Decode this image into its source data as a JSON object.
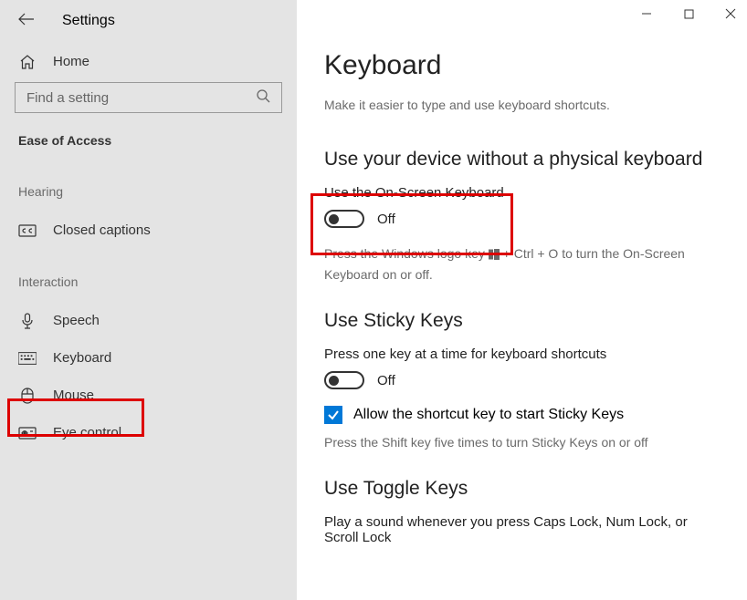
{
  "app_title": "Settings",
  "search_placeholder": "Find a setting",
  "home_label": "Home",
  "category_title": "Ease of Access",
  "sections": {
    "hearing": "Hearing",
    "interaction": "Interaction"
  },
  "nav": {
    "closed_captions": "Closed captions",
    "speech": "Speech",
    "keyboard": "Keyboard",
    "mouse": "Mouse",
    "eye_control": "Eye control"
  },
  "main": {
    "title": "Keyboard",
    "subtitle": "Make it easier to type and use keyboard shortcuts.",
    "osk_heading": "Use your device without a physical keyboard",
    "osk_label": "Use the On-Screen Keyboard",
    "osk_state": "Off",
    "osk_hint_pre": "Press the Windows logo key ",
    "osk_hint_post": " + Ctrl + O to turn the On-Screen Keyboard on or off.",
    "sticky_heading": "Use Sticky Keys",
    "sticky_label": "Press one key at a time for keyboard shortcuts",
    "sticky_state": "Off",
    "sticky_checkbox": "Allow the shortcut key to start Sticky Keys",
    "sticky_hint": "Press the Shift key five times to turn Sticky Keys on or off",
    "toggle_heading": "Use Toggle Keys",
    "toggle_label": "Play a sound whenever you press Caps Lock, Num Lock, or Scroll Lock"
  }
}
